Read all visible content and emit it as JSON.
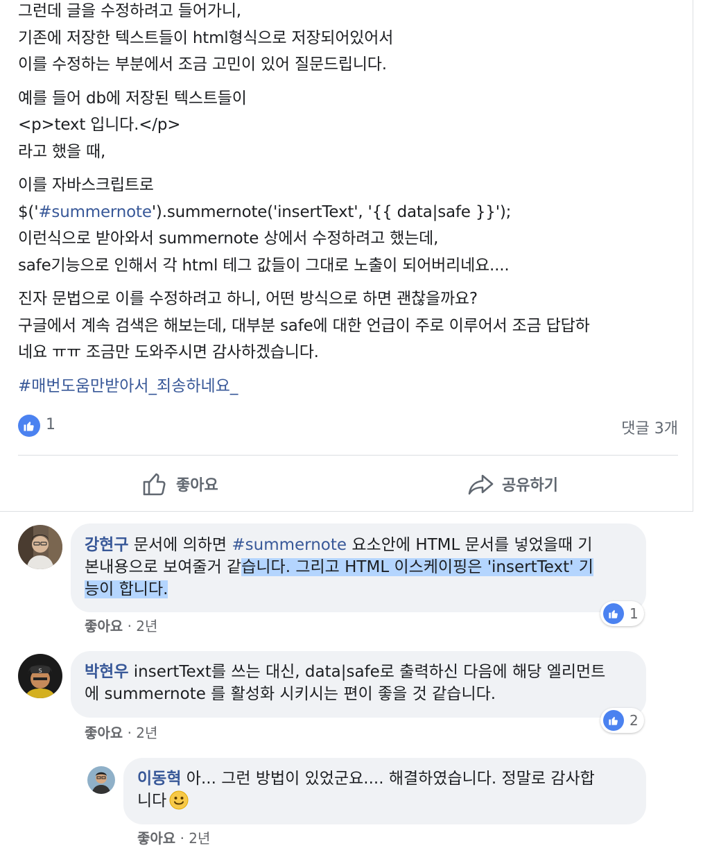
{
  "post": {
    "paragraphs": [
      [
        "그런데 글을 수정하려고 들어가니,",
        "기존에 저장한 텍스트들이 html형식으로 저장되어있어서",
        "이를 수정하는 부분에서 조금 고민이 있어 질문드립니다."
      ],
      [
        "예를 들어 db에 저장된 텍스트들이",
        "<p>text 입니다.</p>",
        "라고 했을 때,"
      ],
      [
        "이를 자바스크립트로"
      ],
      [
        "이런식으로 받아와서 summernote 상에서 수정하려고 했는데,",
        "safe기능으로 인해서 각 html 테그 값들이 그대로 노출이 되어버리네요...."
      ],
      [
        "진자 문법으로 이를 수정하려고 하니, 어떤 방식으로 하면 괜찮을까요?",
        "구글에서 계속 검색은 해보는데, 대부분 safe에 대한 언급이 주로 이루어서 조금 답답하",
        "네요 ㅠㅠ 조금만 도와주시면 감사하겠습니다."
      ]
    ],
    "code_line": {
      "prefix": "$('",
      "tag": "#summernote",
      "suffix": "').summernote('insertText', '{{ data|safe }}');"
    },
    "hashtag": "#매번도움만받아서_죄송하네요_",
    "reaction_count": "1",
    "comment_count": "댓글 3개",
    "actions": {
      "like": "좋아요",
      "share": "공유하기"
    }
  },
  "comments": [
    {
      "author": "강현구",
      "text_a": "문서에 의하면 ",
      "tag": "#summernote",
      "text_b": " 요소안에 HTML 문서를 넣었을때 기",
      "line2_plain": "본내용으로 보여줄거 같",
      "line2_selected": "습니다. 그리고 HTML 이스케이핑은 'insertText' 기",
      "line3_selected": "능이 합니다.",
      "like_label": "좋아요",
      "time": "· 2년",
      "reaction_count": "1"
    },
    {
      "author": "박현우",
      "line1": " insertText를 쓰는 대신, data|safe로 출력하신 다음에 해당 엘리먼트",
      "line2": "에 summernote 를 활성화 시키시는 편이 좋을 것 같습니다.",
      "like_label": "좋아요",
      "time": "· 2년",
      "reaction_count": "2"
    },
    {
      "author": "이동혁",
      "line1": " 아... 그런 방법이 있었군요.... 해결하였습니다. 정말로 감사합",
      "line2": "니다",
      "like_label": "좋아요",
      "time": "· 2년"
    }
  ],
  "colors": {
    "link": "#385898",
    "like_blue": "#4b82f0",
    "bubble": "#f0f2f5",
    "selection": "#b4d5fe"
  },
  "icons": [
    "thumbs-up-icon",
    "share-arrow-icon",
    "smiley-emoji-icon"
  ]
}
